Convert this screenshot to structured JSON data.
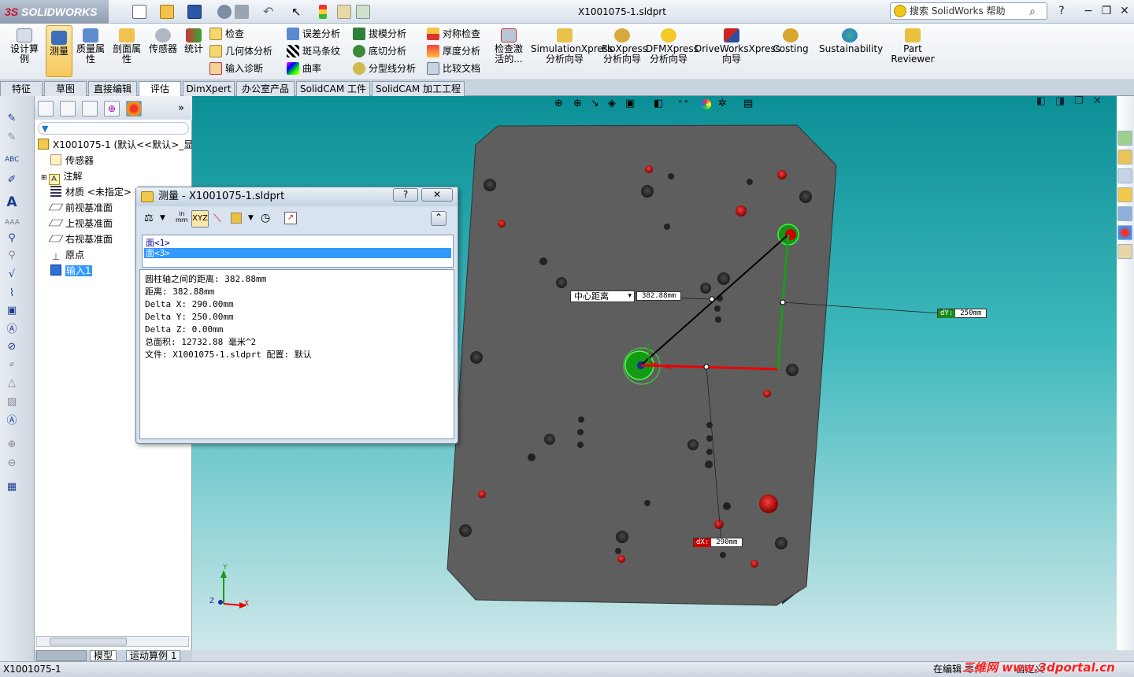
{
  "app": {
    "brand_prefix": "3S",
    "brand": "SOLIDWORKS",
    "doc_title": "X1001075-1.sldprt"
  },
  "search": {
    "placeholder": "搜索 SolidWorks 帮助"
  },
  "window_controls": {
    "help": "?",
    "minimize": "−",
    "restore": "❐",
    "close": "✕"
  },
  "ribbon": {
    "design_check": "设计算例",
    "measure": "测量",
    "mass_props": "质量属性",
    "section_props": "剖面属性",
    "sensor": "传感器",
    "stats": "统计",
    "check": "检查",
    "geometry_analysis": "几何体分析",
    "import_diag": "输入诊断",
    "deviation": "误差分析",
    "zebra": "斑马条纹",
    "curvature": "曲率",
    "draft": "拔模分析",
    "undercut": "底切分析",
    "parting": "分型线分析",
    "symmetry": "对称检查",
    "thickness": "厚度分析",
    "compare": "比较文档",
    "check_active": "检查激活的...",
    "simxpress": "SimulationXpress 分析向导",
    "floxpress": "FloXpress 分析向导",
    "dfmxpress": "DFMXpress 分析向导",
    "driveworks": "DriveWorksXpress 向导",
    "costing": "Costing",
    "sustainability": "Sustainability",
    "part_reviewer": "Part Reviewer"
  },
  "tabs": [
    "特征",
    "草图",
    "直接编辑",
    "评估",
    "DimXpert",
    "办公室产品",
    "SolidCAM 工件",
    "SolidCAM 加工工程"
  ],
  "tree": {
    "root": "X1001075-1  (默认<<默认>_显",
    "items": [
      "传感器",
      "注解",
      "材质 <未指定>",
      "前视基准面",
      "上视基准面",
      "右视基准面",
      "原点",
      "输入1"
    ]
  },
  "bottom_tabs": {
    "model": "模型",
    "motion": "运动算例 1"
  },
  "status": {
    "file": "X1001075-1",
    "mode": "在编辑 零件",
    "custom": "自定义"
  },
  "measure_dialog": {
    "title": "测量 - X1001075-1.sldprt",
    "help": "?",
    "close": "✕",
    "collapse": "⌃",
    "selections": [
      "面<1>",
      "面<3>"
    ],
    "results": [
      "圆柱轴之间的距离:  382.88mm",
      "距离: 382.88mm",
      "Delta X: 290.00mm",
      "Delta Y: 250.00mm",
      "Delta Z: 0.00mm",
      "总面积: 12732.88 毫米^2",
      "文件:  X1001075-1.sldprt 配置: 默认"
    ]
  },
  "viewport_labels": {
    "center_distance_key": "中心距离",
    "center_distance_value": "382.88mm",
    "dy_key": "dY:",
    "dy_value": "250mm",
    "dx_key": "dX:",
    "dx_value": "290mm"
  },
  "triad": {
    "x": "X",
    "y": "Y",
    "z": "Z"
  },
  "watermark": "三维网 www.3dportal.cn",
  "colors": {
    "viewport_top": "#0b8f96",
    "plate": "#5e5e5e",
    "hole_red": "#b50000",
    "selection_green": "#22cc22",
    "measure_line": "#000000",
    "dx_line": "#e00000"
  }
}
